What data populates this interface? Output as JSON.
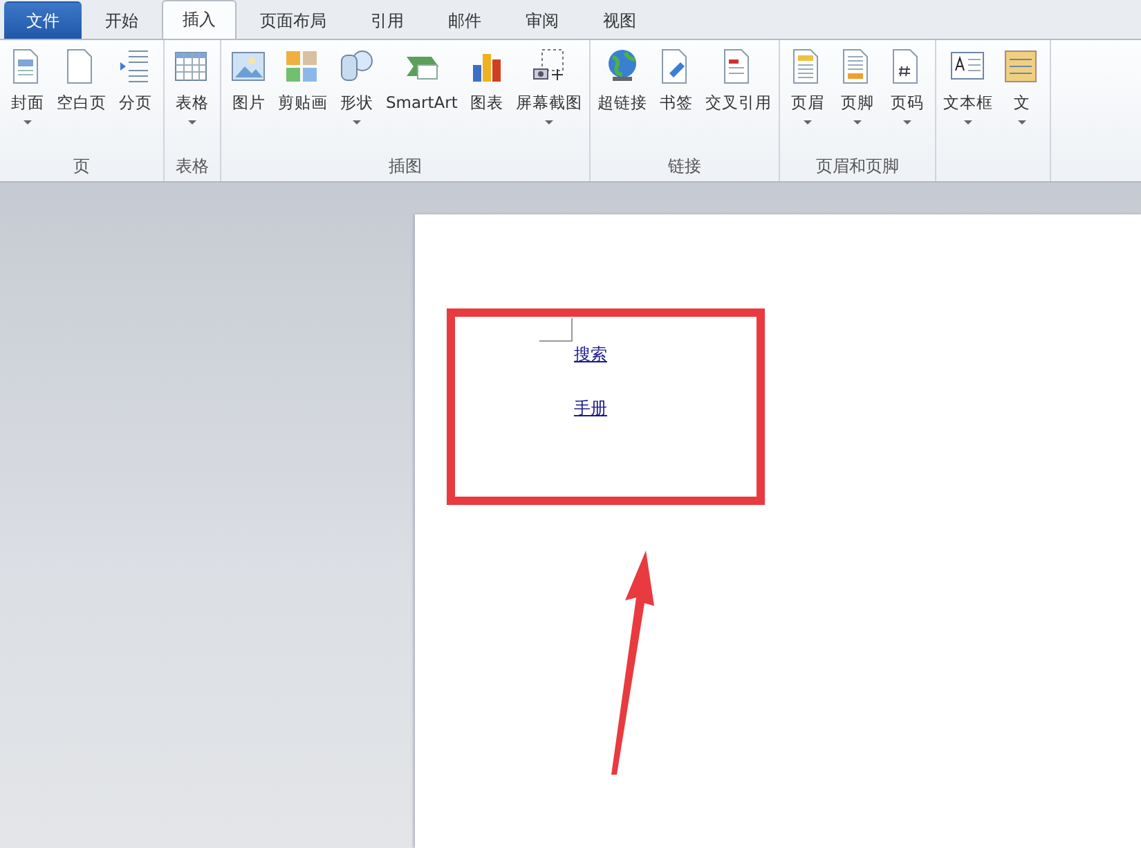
{
  "tabs": [
    {
      "label": "文件",
      "kind": "file",
      "selected": false
    },
    {
      "label": "开始",
      "kind": "tab",
      "selected": false
    },
    {
      "label": "插入",
      "kind": "tab",
      "selected": true
    },
    {
      "label": "页面布局",
      "kind": "tab",
      "selected": false
    },
    {
      "label": "引用",
      "kind": "tab",
      "selected": false
    },
    {
      "label": "邮件",
      "kind": "tab",
      "selected": false
    },
    {
      "label": "审阅",
      "kind": "tab",
      "selected": false
    },
    {
      "label": "视图",
      "kind": "tab",
      "selected": false
    }
  ],
  "ribbon_groups": [
    {
      "name": "页",
      "buttons": [
        {
          "label": "封面",
          "dropdown": true
        },
        {
          "label": "空白页",
          "dropdown": false
        },
        {
          "label": "分页",
          "dropdown": false
        }
      ]
    },
    {
      "name": "表格",
      "buttons": [
        {
          "label": "表格",
          "dropdown": true
        }
      ]
    },
    {
      "name": "插图",
      "buttons": [
        {
          "label": "图片",
          "dropdown": false
        },
        {
          "label": "剪贴画",
          "dropdown": false
        },
        {
          "label": "形状",
          "dropdown": true
        },
        {
          "label": "SmartArt",
          "dropdown": false
        },
        {
          "label": "图表",
          "dropdown": false
        },
        {
          "label": "屏幕截图",
          "dropdown": true
        }
      ]
    },
    {
      "name": "链接",
      "buttons": [
        {
          "label": "超链接",
          "dropdown": false
        },
        {
          "label": "书签",
          "dropdown": false
        },
        {
          "label": "交叉引用",
          "dropdown": false
        }
      ]
    },
    {
      "name": "页眉和页脚",
      "buttons": [
        {
          "label": "页眉",
          "dropdown": true
        },
        {
          "label": "页脚",
          "dropdown": true
        },
        {
          "label": "页码",
          "dropdown": true
        }
      ]
    },
    {
      "buttons": [
        {
          "label": "文本框",
          "dropdown": true
        },
        {
          "label": "文",
          "dropdown": true
        }
      ]
    }
  ],
  "document": {
    "links": [
      "搜索",
      "手册"
    ]
  }
}
